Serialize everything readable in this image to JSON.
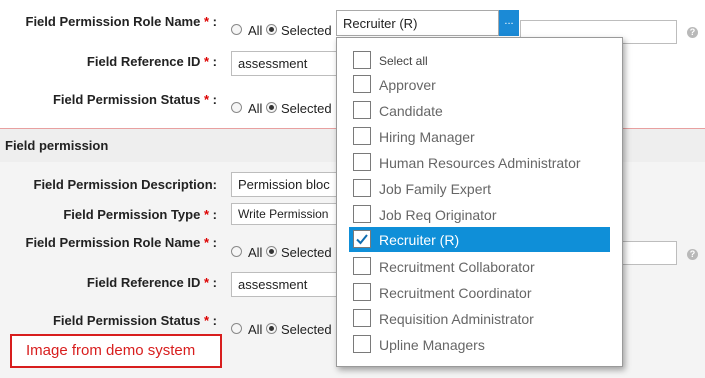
{
  "top": {
    "role_label": "Field Permission Role Name",
    "role_all": "All",
    "role_selected": "Selected",
    "role_select_value": "Recruiter (R)",
    "role_browse": "...",
    "ref_label": "Field Reference ID",
    "ref_value": "assessment",
    "status_label": "Field Permission Status",
    "status_all": "All",
    "status_selected": "Selected",
    "required_mark": "*",
    "colon": ":"
  },
  "section": {
    "title": "Field permission",
    "desc_label": "Field Permission Description:",
    "desc_value": "Permission bloc",
    "type_label": "Field Permission Type",
    "type_value": "Write Permission",
    "role_label": "Field Permission Role Name",
    "role_all": "All",
    "role_selected": "Selected",
    "ref_label": "Field Reference ID",
    "ref_value": "assessment",
    "status_label": "Field Permission Status",
    "status_all": "All",
    "status_selected": "Selected"
  },
  "help_icon": "?",
  "dropdown": {
    "options": [
      {
        "label": "Select all",
        "checked": false
      },
      {
        "label": "Approver",
        "checked": false
      },
      {
        "label": "Candidate",
        "checked": false
      },
      {
        "label": "Hiring Manager",
        "checked": false
      },
      {
        "label": "Human Resources Administrator",
        "checked": false
      },
      {
        "label": "Job Family Expert",
        "checked": false
      },
      {
        "label": "Job Req Originator",
        "checked": false
      },
      {
        "label": "Recruiter (R)",
        "checked": true
      },
      {
        "label": "Recruitment Collaborator",
        "checked": false
      },
      {
        "label": "Recruitment Coordinator",
        "checked": false
      },
      {
        "label": "Requisition Administrator",
        "checked": false
      },
      {
        "label": "Upline Managers",
        "checked": false
      }
    ]
  },
  "watermark": "Image from demo system",
  "colors": {
    "accent": "#0f8fd8",
    "required": "#dd0000",
    "watermark": "#d81e1e"
  }
}
